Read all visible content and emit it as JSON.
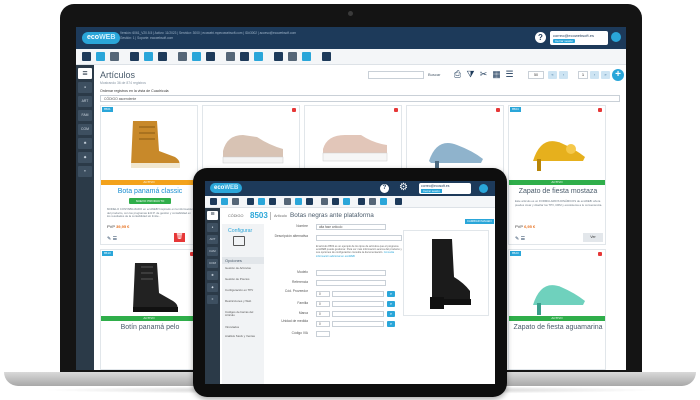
{
  "laptop": {
    "brand": {
      "text_a": "eco",
      "text_b": "WEB"
    },
    "top_info": [
      "Versión: 6061_V20.5.5  |  Activo: 11/2023  |  Servidor: 3000  |  ecowebi.mpecowebsoft.com  |  ID#3002  |  acceso@ecowebsoft.com",
      "Gestión: 1  |  Soporte: ecowebsoft.com"
    ],
    "user": {
      "email": "correo@ecowebsoft.es",
      "logout_label": "Cerrar sesión"
    },
    "page": {
      "title": "Artículos",
      "subtitle": "Mostrando 36 de 874 registros",
      "search_button": "Buscar",
      "page_size": "50",
      "current_page": "1",
      "sort_label": "Ordenar registros en la vista de Cuadrícula",
      "sort_value": "CÓDIGO ascendente"
    },
    "rail": [
      "ART",
      "FAM",
      "COM"
    ],
    "cards": [
      {
        "badge": "8501",
        "status": "ACTIVO",
        "status_color": "#f3a21b",
        "name": "Bota panamá classic",
        "highlight": true,
        "button": "NUEVO PRODUCTO",
        "meta": "MODELO CONTABILIZADO en ecoWEB! Inspirado en la información del producto, con los programas E.R.P. de gestión y contabilidad en los resultados de la contabilidad sin límite...",
        "price_label": "PVP",
        "price": "39,95 €",
        "action": "delete"
      },
      {
        "badge": "",
        "status": "",
        "status_color": "",
        "name": "",
        "highlight": false,
        "button": "",
        "meta": "",
        "price_label": "",
        "price": "",
        "action": ""
      },
      {
        "badge": "",
        "status": "",
        "status_color": "",
        "name": "",
        "highlight": false,
        "button": "",
        "meta": "",
        "price_label": "",
        "price": "",
        "action": ""
      },
      {
        "badge": "",
        "status": "",
        "status_color": "",
        "name": "",
        "highlight": false,
        "button": "",
        "meta": "",
        "price_label": "",
        "price": "",
        "action": ""
      },
      {
        "badge": "8504",
        "status": "ACTIVO",
        "status_color": "#2fae4a",
        "name": "Zapato de fiesta mostaza",
        "highlight": false,
        "button": "",
        "meta": "Este artículo es un FORMULARIOS DINÁMICOS de ecoWEB: ahora puedes crear y diseñar los TPV, CRM y ecosistema a tu conveniencia.",
        "price_label": "PVP",
        "price": "6,95 €",
        "action": "edit"
      }
    ],
    "bottom_cards": [
      {
        "badge": "8513",
        "status": "ACTIVO",
        "status_color": "#2fae4a",
        "name": "Botín panamá pelo"
      },
      {
        "badge": "8523",
        "status": "ACTIVO",
        "status_color": "#2fae4a",
        "name": "Zapato de fiesta aguamarina"
      }
    ],
    "edit_label": "Ver"
  },
  "tablet": {
    "brand": {
      "text_a": "eco",
      "text_b": "WEB"
    },
    "user": {
      "email": "correo@ecosoft.es",
      "logout_label": "Cerrar sesión"
    },
    "code_label": "CÓDIGO",
    "code_value": "8503",
    "article_label": "Artículo",
    "article_title": "Botas negras ante plataforma",
    "config_label": "Configurar",
    "options_title": "Opciones",
    "options": [
      "Gestión de Artículos",
      "Gestión de Precios",
      "Configuración en TPV",
      "Restricciones y Web",
      "Códigos de barras del Artículo",
      "Vinculados",
      "Análisis Stock y Ventas"
    ],
    "form": {
      "nombre_label": "Nombre",
      "nombre_value": "alta fase artículo",
      "desc_label": "Descripción alternativa",
      "desc_text": "El artículo 8503 es un ejemplo de los tipos de artículos que el programa ecoWEB puede gestionar. Para ver más información acerca del producto y sus opciones de configuración consulte la documentación.",
      "desc_link": "Consulta información adicional en ecoWEB",
      "modelo_label": "Modelo",
      "referencia_label": "Referencia",
      "proveedor_label": "Cód. Proveedor",
      "proveedor_value": "0",
      "familia_label": "Familia",
      "familia_value": "0",
      "marca_label": "Marca",
      "marca_value": "0",
      "unidad_label": "Unidad de medida",
      "unidad_value": "0",
      "iva_label": "Código IVA",
      "image_button": "CAMBIAR IMAGEN"
    }
  }
}
